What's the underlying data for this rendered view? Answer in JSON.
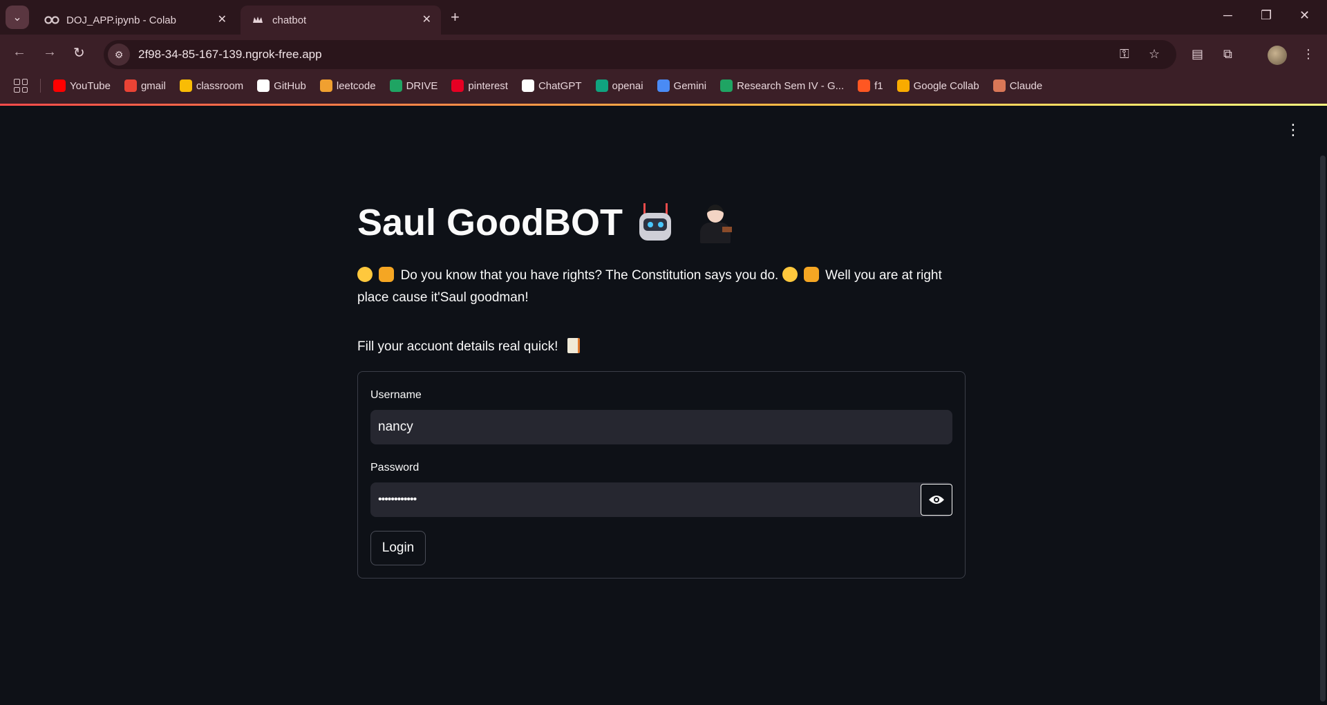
{
  "browser": {
    "tabs": [
      {
        "title": "DOJ_APP.ipynb - Colab",
        "icon": "colab-icon"
      },
      {
        "title": "chatbot",
        "icon": "streamlit-icon"
      }
    ],
    "url": "2f98-34-85-167-139.ngrok-free.app",
    "bookmarks": [
      {
        "label": "YouTube",
        "color": "#ff0000"
      },
      {
        "label": "gmail",
        "color": "#ea4335"
      },
      {
        "label": "classroom",
        "color": "#f9bc05"
      },
      {
        "label": "GitHub",
        "color": "#ffffff"
      },
      {
        "label": "leetcode",
        "color": "#f0a030"
      },
      {
        "label": "DRIVE",
        "color": "#1fa463"
      },
      {
        "label": "pinterest",
        "color": "#e60023"
      },
      {
        "label": "ChatGPT",
        "color": "#ffffff"
      },
      {
        "label": "openai",
        "color": "#10a37f"
      },
      {
        "label": "Gemini",
        "color": "#4a8bf5"
      },
      {
        "label": "Research Sem IV - G...",
        "color": "#1fa463"
      },
      {
        "label": "f1",
        "color": "#ff5722"
      },
      {
        "label": "Google Collab",
        "color": "#f9ab00"
      },
      {
        "label": "Claude",
        "color": "#d97757"
      }
    ]
  },
  "app": {
    "title": "Saul GoodBOT",
    "description": "Do you know that you have rights? The Constitution says you do.",
    "description_tail": "Well you are at right place cause it'Saul goodman!",
    "fill_prompt": "Fill your accuont details real quick!",
    "form": {
      "username_label": "Username",
      "username_value": "nancy",
      "password_label": "Password",
      "password_value": "••••••••••••",
      "login_label": "Login"
    }
  }
}
